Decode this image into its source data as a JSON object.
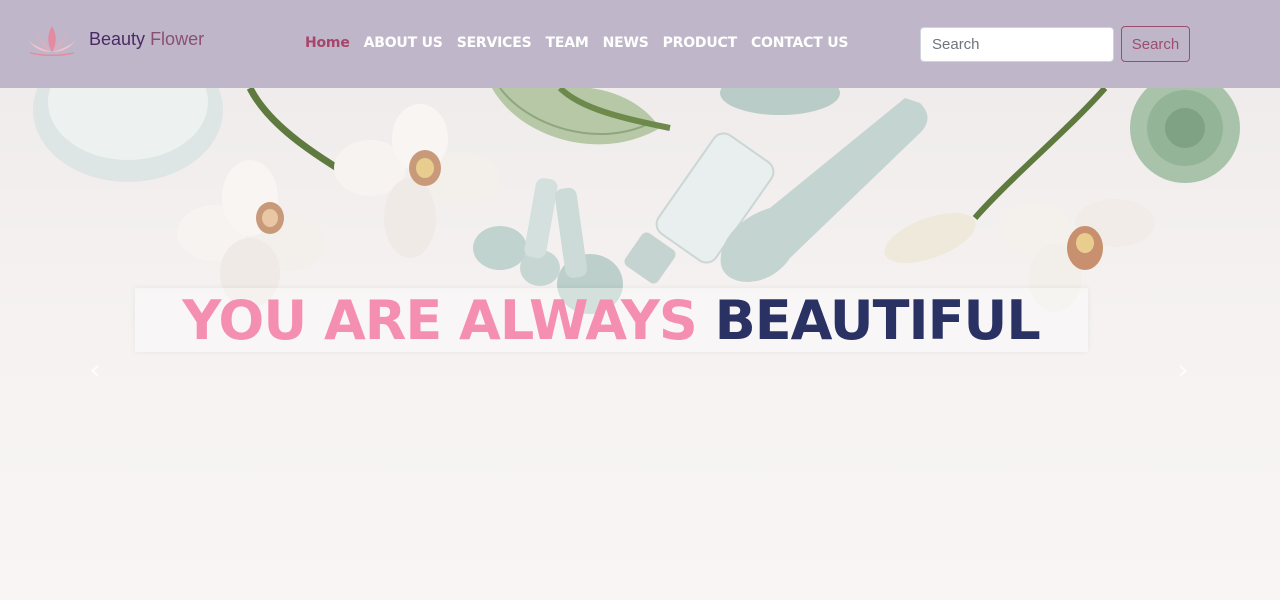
{
  "brand": {
    "name_part1": "Beauty",
    "name_part2": "Flower",
    "logo_icon": "lotus-icon"
  },
  "nav": {
    "items": [
      {
        "label": "Home",
        "active": true
      },
      {
        "label": "ABOUT US",
        "active": false
      },
      {
        "label": "SERVICES",
        "active": false
      },
      {
        "label": "TEAM",
        "active": false
      },
      {
        "label": "NEWS",
        "active": false
      },
      {
        "label": "PRODUCT",
        "active": false
      },
      {
        "label": "CONTACT US",
        "active": false
      }
    ]
  },
  "search": {
    "placeholder": "Search",
    "button_label": "Search"
  },
  "hero": {
    "caption_part1": "YOU ARE ALWAYS",
    "caption_part2": "BEAUTIFUL",
    "prev_icon": "chevron-left-icon",
    "next_icon": "chevron-right-icon"
  },
  "colors": {
    "navbar_bg": "#bfb7c9",
    "nav_active": "#a8456a",
    "caption_pink": "#f58fb1",
    "caption_navy": "#2a3263",
    "search_button_border": "#9c4d6d"
  }
}
